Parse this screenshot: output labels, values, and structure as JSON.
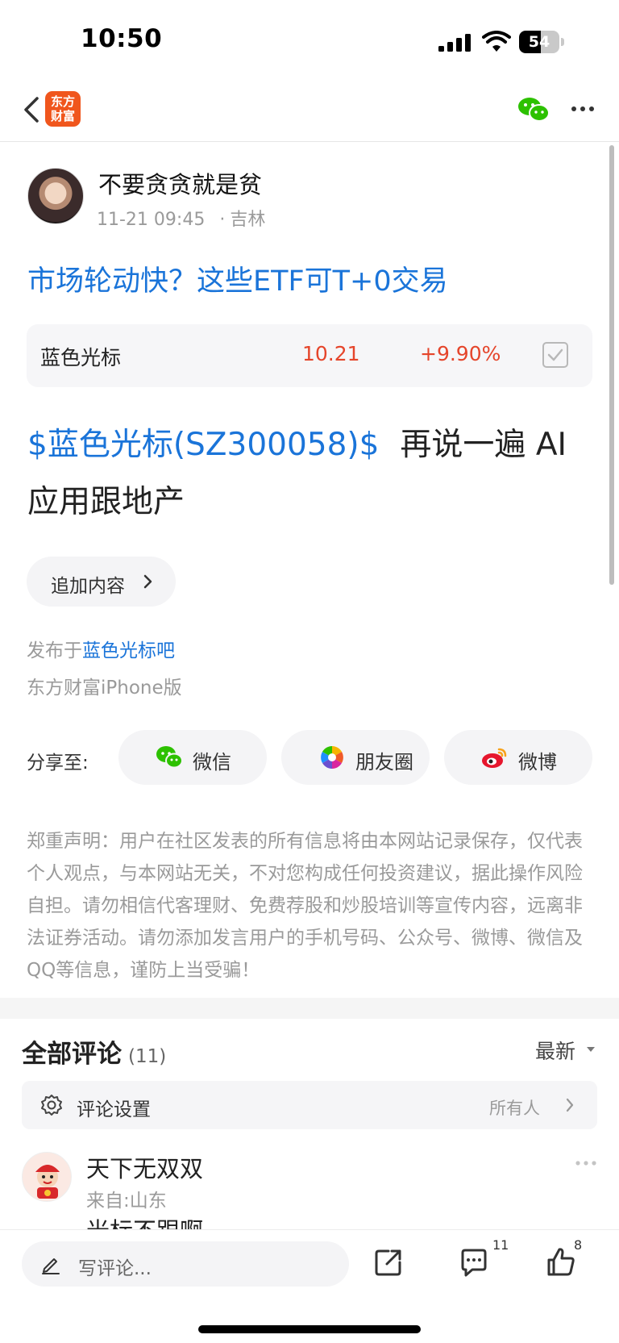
{
  "status_bar": {
    "time": "10:50",
    "battery": "54",
    "battery_level": 0.54
  },
  "nav": {
    "logo_text": "东方\n财富",
    "icons": [
      "back-icon",
      "wechat-icon",
      "more-icon"
    ]
  },
  "author": {
    "name": "不要贪贪就是贫",
    "date": "11-21 09:45",
    "dot": "·",
    "location": "吉林"
  },
  "post": {
    "title": "市场轮动快？这些ETF可T+0交易",
    "stock": {
      "name": "蓝色光标",
      "price": "10.21",
      "change": "+9.90%"
    },
    "stock_link": "$蓝色光标(SZ300058)$",
    "body": "再说一遍 AI应用跟地产",
    "append_label": "追加内容",
    "published_prefix": "发布于",
    "published_bar": "蓝色光标吧",
    "client": "东方财富iPhone版"
  },
  "share": {
    "label": "分享至:",
    "buttons": [
      {
        "label": "微信",
        "icon": "wechat-icon"
      },
      {
        "label": "朋友圈",
        "icon": "moments-icon"
      },
      {
        "label": "微博",
        "icon": "weibo-icon"
      }
    ]
  },
  "disclaimer": "郑重声明：用户在社区发表的所有信息将由本网站记录保存，仅代表个人观点，与本网站无关，不对您构成任何投资建议，据此操作风险自担。请勿相信代客理财、免费荐股和炒股培训等宣传内容，远离非法证券活动。请勿添加发言用户的手机号码、公众号、微博、微信及QQ等信息，谨防上当受骗！",
  "comments": {
    "title": "全部评论",
    "count": "(11)",
    "sort": "最新",
    "settings_label": "评论设置",
    "settings_value": "所有人",
    "items": [
      {
        "user": "天下无双双",
        "from": "来自:山东",
        "text": "光标不跟啊"
      }
    ]
  },
  "bottom_bar": {
    "write_placeholder": "写评论...",
    "comment_count": "11",
    "like_count": "8"
  },
  "colors": {
    "link_blue": "#1a74d9",
    "rise_red": "#e5452b",
    "brand_orange": "#f0561d",
    "muted_gray": "#9a9a9a"
  }
}
